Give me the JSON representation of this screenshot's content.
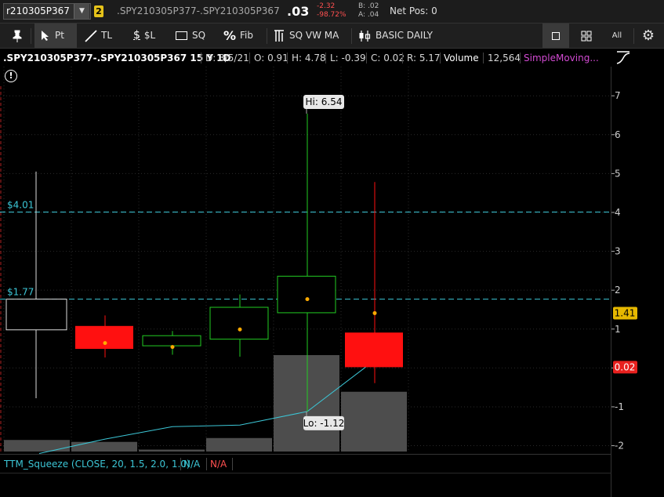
{
  "quote": {
    "symbol": "r210305P367",
    "link_badge": "2",
    "spread_symbol": ".SPY210305P377-.SPY210305P367",
    "last": ".03",
    "change": "-2.32",
    "change_pct": "-98.72%",
    "bid": "B: .02",
    "ask": "A: .04",
    "net_pos": "Net Pos: 0"
  },
  "toolbar": {
    "pin_icon": "pin-icon",
    "pointer": "Pt",
    "trendline": "TL",
    "price_level": "$L",
    "square": "SQ",
    "fib": "Fib",
    "sqvwma": "SQ VW MA",
    "style": "BASIC DAILY",
    "all": "All"
  },
  "info": {
    "title": ".SPY210305P377-.SPY210305P367 15 Y 1D",
    "date": "D: 3/5/21",
    "open": "O: 0.91",
    "high": "H: 4.78",
    "low": "L: -0.39",
    "close": "C: 0.02",
    "range": "R: 5.17",
    "volume_label": "Volume",
    "volume": "12,564",
    "study": "SimpleMoving..."
  },
  "colors": {
    "up": "#22cc22",
    "down": "#ff1010",
    "hline": "#3cc6d6",
    "volume": "#4d4d4d",
    "sma": "#3cc6d6",
    "dot": "#ffaa00"
  },
  "chart_data": {
    "type": "candlestick",
    "ylim": [
      -2.15,
      7.75
    ],
    "y_ticks": [
      -2,
      -1,
      0,
      1,
      2,
      3,
      4,
      5,
      6,
      7
    ],
    "candles": [
      {
        "open": 1.77,
        "close": 0.98,
        "high": 5.05,
        "low": -0.78,
        "color": "up",
        "dot": null
      },
      {
        "open": 1.08,
        "close": 0.49,
        "high": 1.35,
        "low": 0.27,
        "color": "down",
        "dot": 0.64
      },
      {
        "open": 0.57,
        "close": 0.83,
        "high": 0.95,
        "low": 0.34,
        "color": "up",
        "dot": 0.54
      },
      {
        "open": 0.74,
        "close": 1.56,
        "high": 1.89,
        "low": 0.29,
        "color": "up",
        "dot": 0.99
      },
      {
        "open": 1.42,
        "close": 2.36,
        "high": 6.54,
        "low": -1.12,
        "color": "up",
        "dot": 1.77
      },
      {
        "open": 0.91,
        "close": 0.02,
        "high": 4.78,
        "low": -0.39,
        "color": "down",
        "dot": 1.41
      }
    ],
    "volume_levels": [
      0.06,
      0.05,
      0.01,
      0.07,
      0.5,
      0.31
    ],
    "sma": [
      -2.2,
      -1.83,
      -1.51,
      -1.47,
      -1.12,
      0.2
    ],
    "price_lines": [
      {
        "label": "$4.01",
        "value": 4.01
      },
      {
        "label": "$1.77",
        "value": 1.77
      }
    ],
    "callouts": {
      "high": "Hi: 6.54",
      "low": "Lo: -1.12"
    },
    "right_labels": [
      {
        "label": "1.41",
        "value": 1.41,
        "color": "#e6b800",
        "text": "#000"
      },
      {
        "label": "0.02",
        "value": 0.02,
        "color": "#e8201e",
        "text": "#fff"
      }
    ]
  },
  "lower_study": {
    "name": "TTM_Squeeze (CLOSE, 20, 1.5, 2.0, 1.0)",
    "value1": "N/A",
    "value2": "N/A"
  }
}
